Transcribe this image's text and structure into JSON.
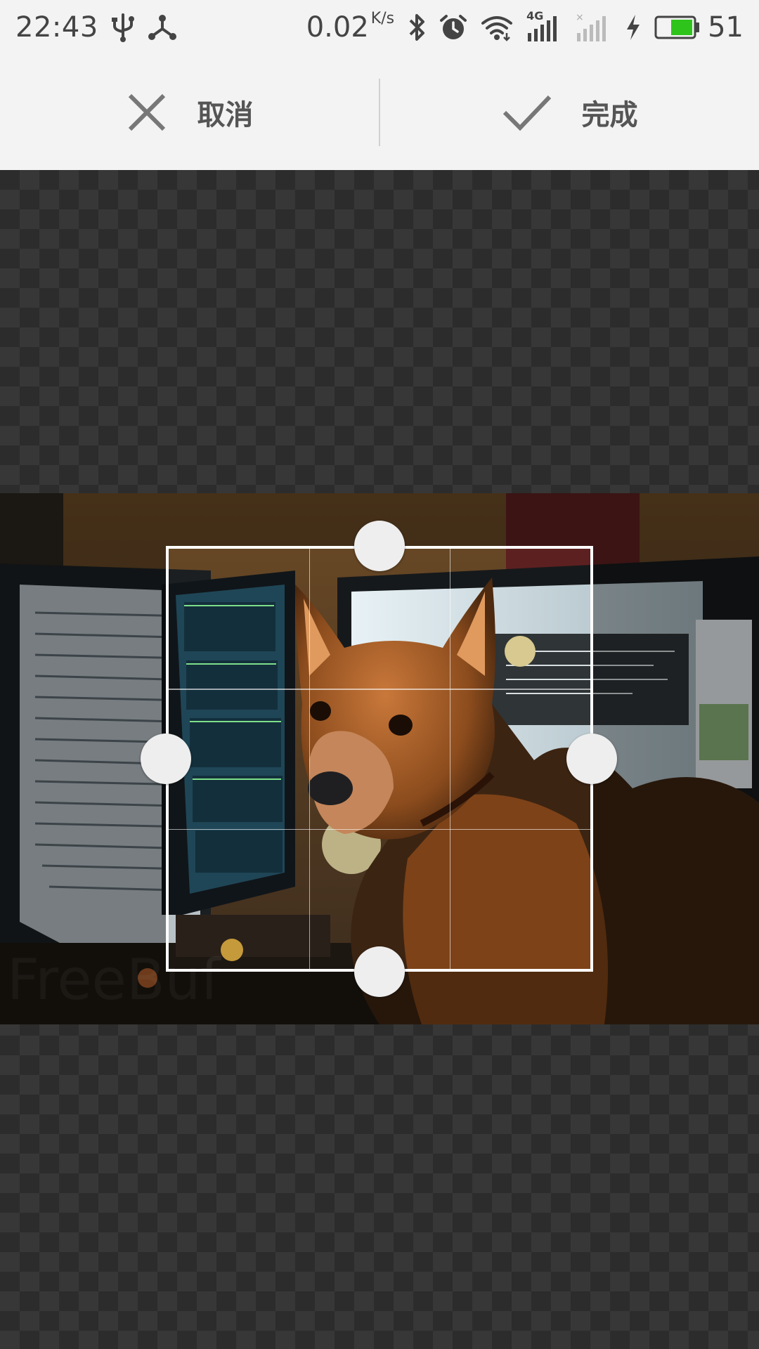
{
  "status_bar": {
    "time": "22:43",
    "network_speed": "0.02",
    "network_speed_unit": "K/s",
    "network_type": "4G",
    "battery_level": "51",
    "battery_color": "#2ec41b",
    "icons": [
      "usb-icon",
      "share-icon",
      "bluetooth-icon",
      "alarm-icon",
      "wifi-icon",
      "signal-icon",
      "signal-empty-icon",
      "charging-icon",
      "battery-icon"
    ]
  },
  "action_bar": {
    "cancel_label": "取消",
    "done_label": "完成",
    "cancel_icon": "close-icon",
    "done_icon": "check-icon"
  },
  "editor": {
    "mode": "crop",
    "photo_subject": "dog",
    "grid": "3x3",
    "handles": [
      "top",
      "left",
      "right",
      "bottom"
    ]
  }
}
